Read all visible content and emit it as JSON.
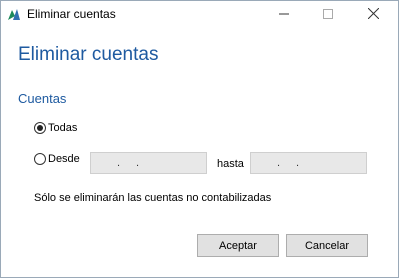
{
  "window": {
    "title": "Eliminar cuentas",
    "icon": "app-logo-icon",
    "controls": [
      "minimize-icon",
      "maximize-icon",
      "close-icon"
    ]
  },
  "heading": "Eliminar cuentas",
  "section_title": "Cuentas",
  "options": {
    "all_label": "Todas",
    "all_selected": true,
    "from_label": "Desde",
    "from_selected": false
  },
  "date_from": {
    "day_sep": ".",
    "month_sep": "."
  },
  "to_label": "hasta",
  "date_to": {
    "day_sep": ".",
    "month_sep": "."
  },
  "note": "Sólo se eliminarán las cuentas no contabilizadas",
  "buttons": {
    "accept": "Aceptar",
    "cancel": "Cancelar"
  },
  "colors": {
    "accent": "#1e5aa0",
    "button_bg": "#e1e1e1",
    "field_bg": "#e8e8e8"
  }
}
